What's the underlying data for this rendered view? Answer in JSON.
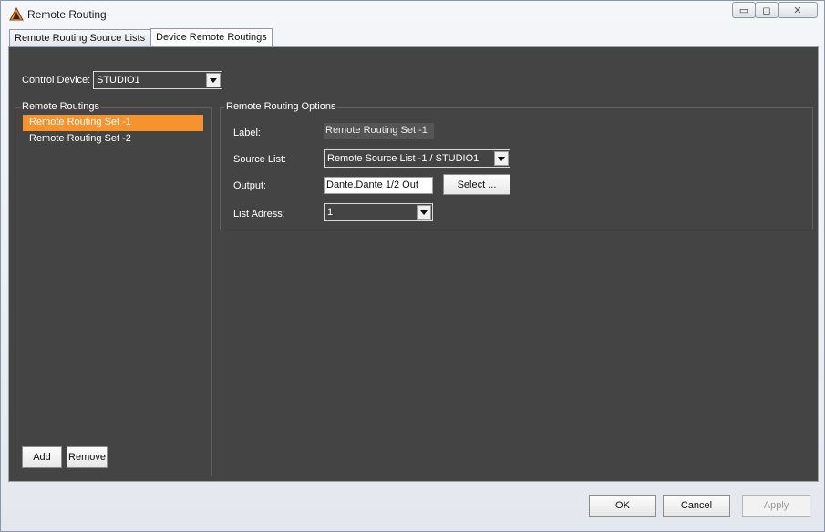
{
  "window": {
    "title": "Remote Routing",
    "controls": {
      "minimize": "▭",
      "maximize": "◻",
      "close": "✕"
    }
  },
  "tabs": [
    {
      "label": "Remote Routing Source Lists",
      "active": false
    },
    {
      "label": "Device Remote Routings",
      "active": true
    }
  ],
  "control_device": {
    "label": "Control Device:",
    "value": "STUDIO1"
  },
  "remote_routings": {
    "title": "Remote Routings",
    "items": [
      {
        "label": "Remote Routing Set -1",
        "selected": true
      },
      {
        "label": "Remote Routing Set -2",
        "selected": false
      }
    ],
    "add_label": "Add",
    "remove_label": "Remove"
  },
  "options": {
    "title": "Remote Routing Options",
    "label_label": "Label:",
    "label_value": "Remote Routing Set -1",
    "source_list_label": "Source List:",
    "source_list_value": "Remote Source List -1 / STUDIO1",
    "output_label": "Output:",
    "output_value": "Dante.Dante 1/2 Out",
    "select_label": "Select ...",
    "list_address_label": "List Adress:",
    "list_address_value": "1"
  },
  "footer": {
    "ok_label": "OK",
    "cancel_label": "Cancel",
    "apply_label": "Apply"
  },
  "colors": {
    "accent": "#f7932f",
    "panel": "#444444"
  }
}
